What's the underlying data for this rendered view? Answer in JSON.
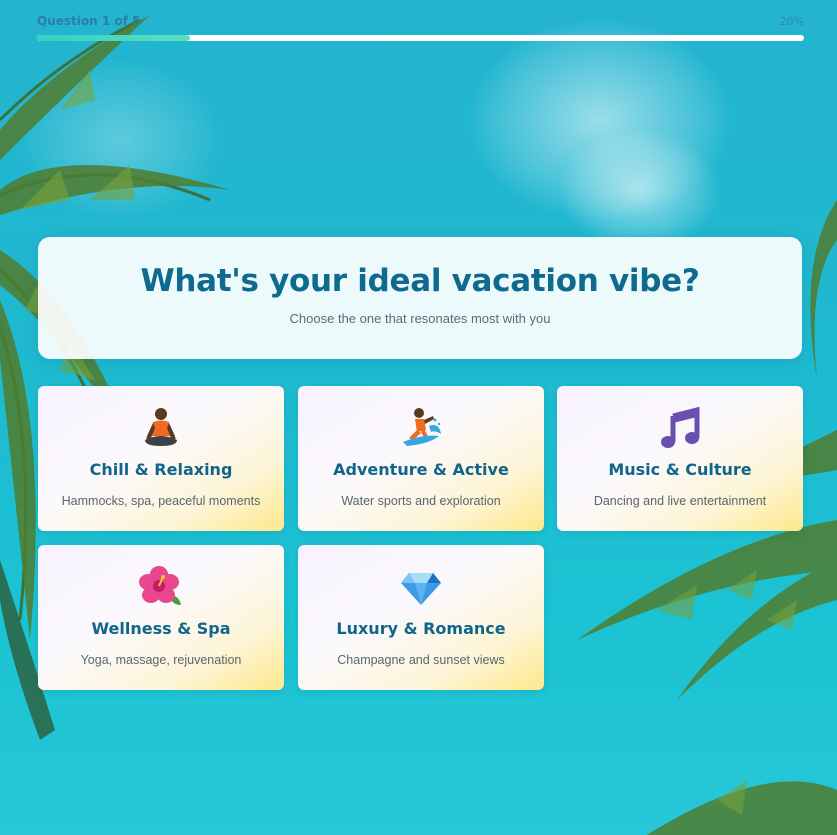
{
  "progress": {
    "label": "Question 1 of 5",
    "percent_label": "20%",
    "fraction": 0.2
  },
  "question": {
    "title": "What's your ideal vacation vibe?",
    "subtitle": "Choose the one that resonates most with you"
  },
  "options": [
    {
      "title": "Chill & Relaxing",
      "description": "Hammocks, spa, peaceful moments",
      "icon": "meditation-icon"
    },
    {
      "title": "Adventure & Active",
      "description": "Water sports and exploration",
      "icon": "surfer-icon"
    },
    {
      "title": "Music & Culture",
      "description": "Dancing and live entertainment",
      "icon": "music-notes-icon"
    },
    {
      "title": "Wellness & Spa",
      "description": "Yoga, massage, rejuvenation",
      "icon": "hibiscus-icon"
    },
    {
      "title": "Luxury & Romance",
      "description": "Champagne and sunset views",
      "icon": "diamond-icon"
    }
  ],
  "colors": {
    "accent": "#0e6a8f",
    "progress_fill": "#33d0c4",
    "background": "#1fb9d0"
  }
}
